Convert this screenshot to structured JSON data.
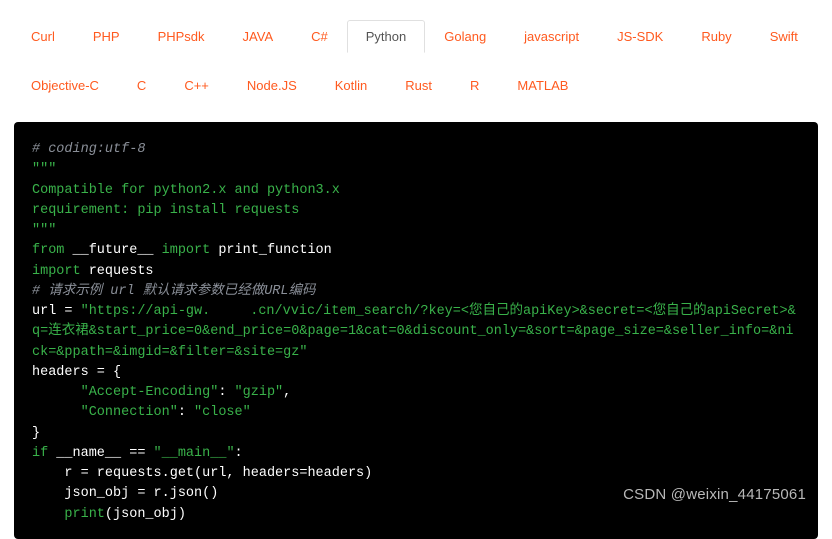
{
  "tabs": {
    "row1": [
      {
        "id": "curl",
        "label": "Curl"
      },
      {
        "id": "php",
        "label": "PHP"
      },
      {
        "id": "phpsdk",
        "label": "PHPsdk"
      },
      {
        "id": "java",
        "label": "JAVA"
      },
      {
        "id": "csharp",
        "label": "C#"
      },
      {
        "id": "python",
        "label": "Python",
        "active": true
      },
      {
        "id": "golang",
        "label": "Golang"
      },
      {
        "id": "javascript",
        "label": "javascript"
      },
      {
        "id": "jssdk",
        "label": "JS-SDK"
      },
      {
        "id": "ruby",
        "label": "Ruby"
      },
      {
        "id": "swift",
        "label": "Swift"
      }
    ],
    "row2": [
      {
        "id": "objc",
        "label": "Objective-C"
      },
      {
        "id": "c",
        "label": "C"
      },
      {
        "id": "cpp",
        "label": "C++"
      },
      {
        "id": "nodejs",
        "label": "Node.JS"
      },
      {
        "id": "kotlin",
        "label": "Kotlin"
      },
      {
        "id": "rust",
        "label": "Rust"
      },
      {
        "id": "r",
        "label": "R"
      },
      {
        "id": "matlab",
        "label": "MATLAB"
      }
    ]
  },
  "code": {
    "c1": "# coding:utf-8",
    "c2": "\"\"\"",
    "c3": "Compatible for python2.x and python3.x",
    "c4": "requirement: pip install requests",
    "c5": "\"\"\"",
    "kw_from": "from",
    "mod_future": " __future__ ",
    "kw_import1": "import",
    "fn_print": " print_function",
    "kw_import2": "import",
    "mod_requests": " requests",
    "c6": "# 请求示例 url 默认请求参数已经做URL编码",
    "var_url": "url = ",
    "url_p1": "\"https://api-gw.",
    "url_p2": ".cn/vvic/item_search/?key=<您自己的apiKey>&secret=<您自己的apiSecret>&q=连衣裙&start_price=0&end_price=0&page=1&cat=0&discount_only=&sort=&page_size=&seller_info=&nick=&ppath=&imgid=&filter=&site=gz\"",
    "h_open": "headers = {",
    "h1k": "      \"Accept-Encoding\"",
    "h1c": ": ",
    "h1v": "\"gzip\"",
    "h1comma": ",",
    "h2k": "      \"Connection\"",
    "h2c": ": ",
    "h2v": "\"close\"",
    "h_close": "}",
    "kw_if": "if",
    "name1": " __name__ ",
    "eqeq": "== ",
    "main_str": "\"__main__\"",
    "colon": ":",
    "l_r": "    r = requests.get(url, headers=headers)",
    "l_json": "    json_obj = r.json()",
    "l_print_kw": "    print",
    "l_print_arg": "(json_obj)"
  },
  "watermark": "CSDN @weixin_44175061"
}
